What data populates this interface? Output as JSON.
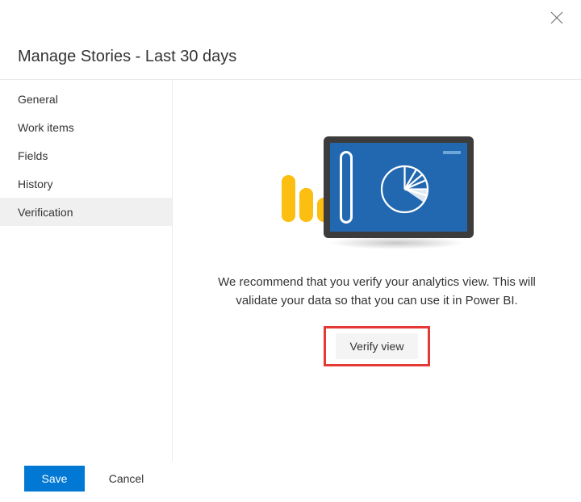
{
  "header": {
    "title": "Manage Stories - Last 30 days"
  },
  "sidebar": {
    "items": [
      {
        "label": "General"
      },
      {
        "label": "Work items"
      },
      {
        "label": "Fields"
      },
      {
        "label": "History"
      },
      {
        "label": "Verification"
      }
    ]
  },
  "main": {
    "description": "We recommend that you verify your analytics view. This will validate your data so that you can use it in Power BI.",
    "verify_label": "Verify view"
  },
  "footer": {
    "save_label": "Save",
    "cancel_label": "Cancel"
  }
}
